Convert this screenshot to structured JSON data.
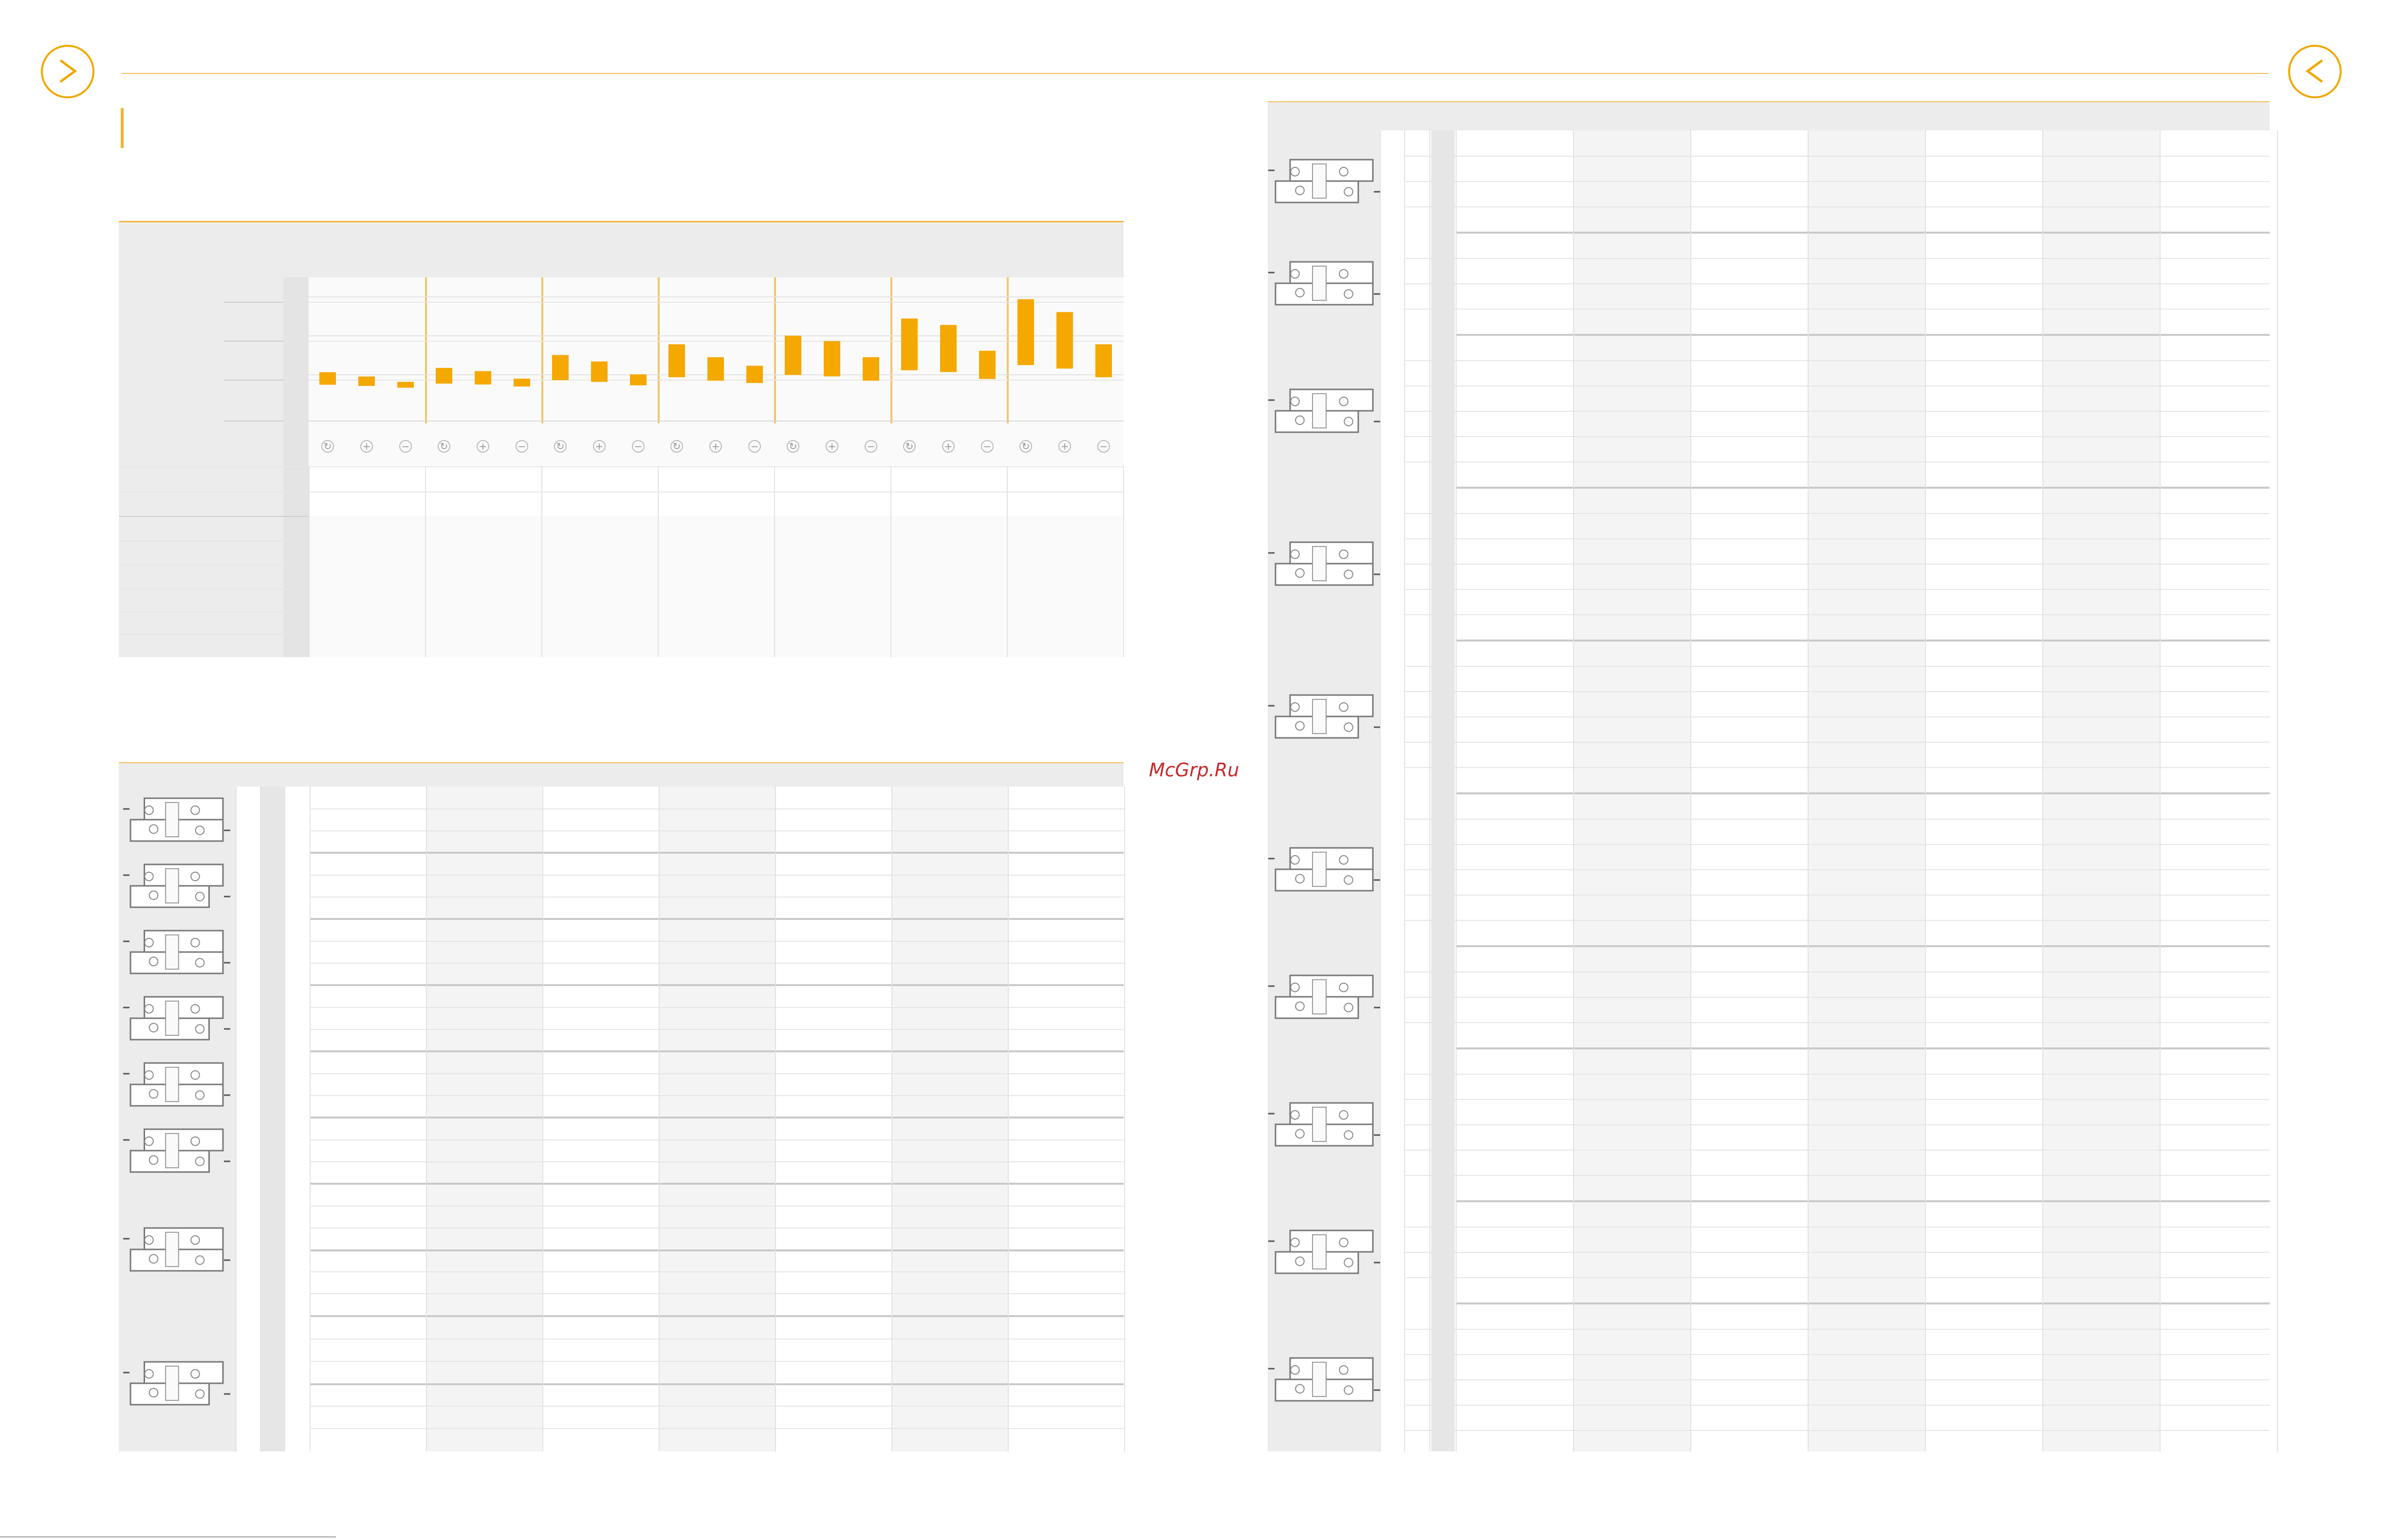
{
  "watermark": {
    "text": "McGrp.Ru"
  },
  "colors": {
    "accent": "#f0b13a",
    "bar": "#f5a800",
    "band": "#ececec"
  },
  "icons": {
    "nav_prev": "chevron-right-icon",
    "nav_next": "chevron-left-icon",
    "mode_set": [
      "cycle-icon",
      "plus-icon",
      "minus-icon"
    ]
  },
  "chart_data": {
    "type": "bar",
    "groups": 7,
    "bars_per_group": 3,
    "series": [
      {
        "values": [
          0.16,
          0.12,
          0.07,
          0.2,
          0.17,
          0.1,
          0.32,
          0.26,
          0.14,
          0.42,
          0.3,
          0.22,
          0.5,
          0.45,
          0.3,
          0.66,
          0.6,
          0.36,
          0.84,
          0.72,
          0.42
        ]
      }
    ],
    "grid": true
  }
}
